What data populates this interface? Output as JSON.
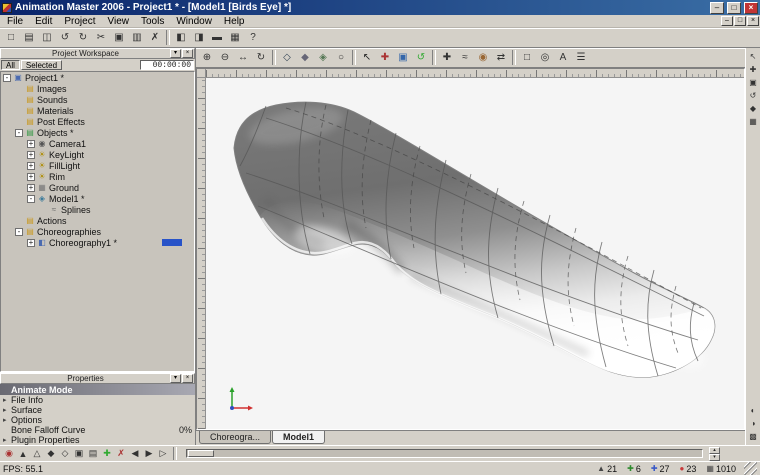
{
  "window": {
    "title": "Animation Master 2006 - Project1 * - [Model1 [Birds Eye] *]",
    "minimize": "–",
    "maximize": "□",
    "close": "×"
  },
  "child_window": {
    "minimize": "–",
    "restore": "□",
    "close": "×"
  },
  "menu": {
    "items": [
      "File",
      "Edit",
      "Project",
      "View",
      "Tools",
      "Window",
      "Help"
    ]
  },
  "toolbar_main": {
    "icons": [
      {
        "name": "new-project-button",
        "glyph": "□"
      },
      {
        "name": "open-project-button",
        "glyph": "▤"
      },
      {
        "name": "save-project-button",
        "glyph": "◫"
      },
      {
        "name": "undo-button",
        "glyph": "↺"
      },
      {
        "name": "redo-button",
        "glyph": "↻"
      },
      {
        "name": "cut-button",
        "glyph": "✂"
      },
      {
        "name": "copy-button",
        "glyph": "▣"
      },
      {
        "name": "paste-button",
        "glyph": "▥"
      },
      {
        "name": "delete-button",
        "glyph": "✗"
      },
      {
        "sep": true
      },
      {
        "name": "workspace-panel-toggle",
        "glyph": "◧"
      },
      {
        "name": "properties-panel-toggle",
        "glyph": "◨"
      },
      {
        "name": "timeline-panel-toggle",
        "glyph": "▬"
      },
      {
        "name": "library-panel-toggle",
        "glyph": "▦"
      },
      {
        "name": "help-button",
        "glyph": "?"
      }
    ]
  },
  "toolbar_view": {
    "icons": [
      {
        "name": "zoom-in-tool",
        "glyph": "⊕",
        "color": "#333333"
      },
      {
        "name": "zoom-out-tool",
        "glyph": "⊖",
        "color": "#333333"
      },
      {
        "name": "move-view-tool",
        "glyph": "↔",
        "color": "#333333"
      },
      {
        "name": "turn-view-tool",
        "glyph": "↻",
        "color": "#333333"
      },
      {
        "sep": true
      },
      {
        "name": "wireframe-mode-button",
        "glyph": "◇",
        "color": "#334455"
      },
      {
        "name": "shaded-mode-button",
        "glyph": "◆",
        "color": "#666677"
      },
      {
        "name": "shaded-wire-mode-button",
        "glyph": "◈",
        "color": "#557755"
      },
      {
        "name": "curved-mode-button",
        "glyph": "○",
        "color": "#333333"
      },
      {
        "sep": true
      },
      {
        "name": "select-tool",
        "glyph": "↖",
        "color": "#222222"
      },
      {
        "name": "translate-tool",
        "glyph": "✚",
        "color": "#aa3333"
      },
      {
        "name": "scale-tool",
        "glyph": "▣",
        "color": "#3366aa"
      },
      {
        "name": "rotate-tool",
        "glyph": "↺",
        "color": "#33aa33"
      },
      {
        "sep": true
      },
      {
        "name": "add-point-tool",
        "glyph": "✚",
        "color": "#333333"
      },
      {
        "name": "stitch-tool",
        "glyph": "≈",
        "color": "#333333"
      },
      {
        "name": "lathe-tool",
        "glyph": "◉",
        "color": "#996633"
      },
      {
        "name": "extrude-tool",
        "glyph": "⇄",
        "color": "#333333"
      },
      {
        "sep": true
      },
      {
        "name": "group-tool",
        "glyph": "□",
        "color": "#333333"
      },
      {
        "name": "lasso-tool",
        "glyph": "◎",
        "color": "#333333"
      },
      {
        "name": "font-tool",
        "glyph": "A",
        "color": "#333333"
      },
      {
        "name": "primitives-tool",
        "glyph": "☰",
        "color": "#333333"
      }
    ]
  },
  "workspace": {
    "title": "Project Workspace",
    "filter_all": "All",
    "filter_selected": "Selected",
    "time_display": "00:00:00",
    "tree": [
      {
        "name": "tree-item-project1",
        "label": "Project1 *",
        "depth": 0,
        "exp": "-",
        "glyph": "▣",
        "color": "#4a6ab0"
      },
      {
        "name": "tree-item-images",
        "label": "Images",
        "depth": 1,
        "exp": "",
        "glyph": "▤",
        "color": "#c89820"
      },
      {
        "name": "tree-item-sounds",
        "label": "Sounds",
        "depth": 1,
        "exp": "",
        "glyph": "▤",
        "color": "#c89820"
      },
      {
        "name": "tree-item-materials",
        "label": "Materials",
        "depth": 1,
        "exp": "",
        "glyph": "▤",
        "color": "#c89820"
      },
      {
        "name": "tree-item-post-effects",
        "label": "Post Effects",
        "depth": 1,
        "exp": "",
        "glyph": "▤",
        "color": "#c89820"
      },
      {
        "name": "tree-item-objects",
        "label": "Objects *",
        "depth": 1,
        "exp": "-",
        "glyph": "▤",
        "color": "#3a9a4a"
      },
      {
        "name": "tree-item-camera1",
        "label": "Camera1",
        "depth": 2,
        "exp": "+",
        "glyph": "◉",
        "color": "#555555"
      },
      {
        "name": "tree-item-keylight",
        "label": "KeyLight",
        "depth": 2,
        "exp": "+",
        "glyph": "☀",
        "color": "#b09010"
      },
      {
        "name": "tree-item-filllight",
        "label": "FillLight",
        "depth": 2,
        "exp": "+",
        "glyph": "☀",
        "color": "#b09010"
      },
      {
        "name": "tree-item-rim",
        "label": "Rim",
        "depth": 2,
        "exp": "+",
        "glyph": "☀",
        "color": "#b09010"
      },
      {
        "name": "tree-item-ground",
        "label": "Ground",
        "depth": 2,
        "exp": "+",
        "glyph": "▦",
        "color": "#777777"
      },
      {
        "name": "tree-item-model1",
        "label": "Model1 *",
        "depth": 2,
        "exp": "-",
        "glyph": "◈",
        "color": "#3a7a9a"
      },
      {
        "name": "tree-item-splines",
        "label": "Splines",
        "depth": 3,
        "exp": "",
        "glyph": "≈",
        "color": "#666666"
      },
      {
        "name": "tree-item-actions",
        "label": "Actions",
        "depth": 1,
        "exp": "",
        "glyph": "▤",
        "color": "#c89820"
      },
      {
        "name": "tree-item-choreographies",
        "label": "Choreographies",
        "depth": 1,
        "exp": "-",
        "glyph": "▤",
        "color": "#c89820"
      },
      {
        "name": "tree-item-choreography1",
        "label": "Choreography1 *",
        "depth": 2,
        "exp": "+",
        "glyph": "◧",
        "color": "#4a6ab0",
        "blue": true
      }
    ]
  },
  "properties": {
    "title": "Properties",
    "rows": [
      {
        "name": "prop-animate-mode",
        "label": "Animate Mode",
        "hdr": true,
        "arrow": "",
        "value": ""
      },
      {
        "name": "prop-file-info",
        "label": "File Info",
        "arrow": "▸",
        "value": ""
      },
      {
        "name": "prop-surface",
        "label": "Surface",
        "arrow": "▸",
        "value": ""
      },
      {
        "name": "prop-options",
        "label": "Options",
        "arrow": "▸",
        "value": ""
      },
      {
        "name": "prop-bone-falloff-curve",
        "label": "Bone Falloff Curve",
        "arrow": "",
        "value": "0%"
      },
      {
        "name": "prop-plugin-properties",
        "label": "Plugin Properties",
        "arrow": "▸",
        "value": ""
      }
    ]
  },
  "viewport": {
    "tabs": [
      {
        "name": "tab-choreography1",
        "label": "Choreogra..."
      },
      {
        "name": "tab-model1",
        "label": "Model1",
        "active": true
      }
    ]
  },
  "right_toolbar": {
    "top_icons": [
      {
        "name": "standard-manipulator-button",
        "glyph": "↖"
      },
      {
        "name": "translate-manipulator-button",
        "glyph": "✚"
      },
      {
        "name": "scale-manipulator-button",
        "glyph": "▣"
      },
      {
        "name": "rotate-manipulator-button",
        "glyph": "↺"
      },
      {
        "name": "show-manipulators-button",
        "glyph": "◆"
      },
      {
        "name": "show-grid-button",
        "glyph": "▦"
      }
    ],
    "bottom_icons": [
      {
        "name": "show-bias-handles-button",
        "glyph": "◐"
      },
      {
        "name": "mirror-mode-button",
        "glyph": "◑"
      },
      {
        "name": "snap-to-grid-button",
        "glyph": "▩"
      }
    ]
  },
  "bottom_toolbar": {
    "icons": [
      {
        "name": "animate-mode-toggle",
        "glyph": "◉",
        "color": "#aa3333"
      },
      {
        "name": "skeletal-mode-button",
        "glyph": "▲"
      },
      {
        "name": "muscle-mode-button",
        "glyph": "△"
      },
      {
        "name": "bones-mode-button",
        "glyph": "◆"
      },
      {
        "name": "model-key-button",
        "glyph": "◇"
      },
      {
        "name": "branch-key-button",
        "glyph": "▣"
      },
      {
        "name": "bone-key-button",
        "glyph": "▤"
      },
      {
        "name": "force-keyframe-button",
        "glyph": "✚",
        "color": "#33aa33"
      },
      {
        "name": "delete-keyframe-button",
        "glyph": "✗",
        "color": "#aa3333"
      },
      {
        "name": "prev-frame-button",
        "glyph": "◀"
      },
      {
        "name": "play-button",
        "glyph": "▶"
      },
      {
        "name": "next-frame-button",
        "glyph": "▷"
      }
    ],
    "spin_up": "▴",
    "spin_down": "▾"
  },
  "status": {
    "fps": "FPS: 55.1",
    "counts": [
      {
        "name": "cp-count",
        "glyph": "▲",
        "color": "#444444",
        "value": "21"
      },
      {
        "name": "spline-count",
        "glyph": "✚",
        "color": "#2e8b2e",
        "value": "6"
      },
      {
        "name": "patch-count",
        "glyph": "✚",
        "color": "#3a5ac8",
        "value": "27"
      },
      {
        "name": "group-count",
        "glyph": "●",
        "color": "#c83a3a",
        "value": "23"
      },
      {
        "name": "render-count",
        "glyph": "▦",
        "color": "#444444",
        "value": "1010"
      }
    ]
  }
}
